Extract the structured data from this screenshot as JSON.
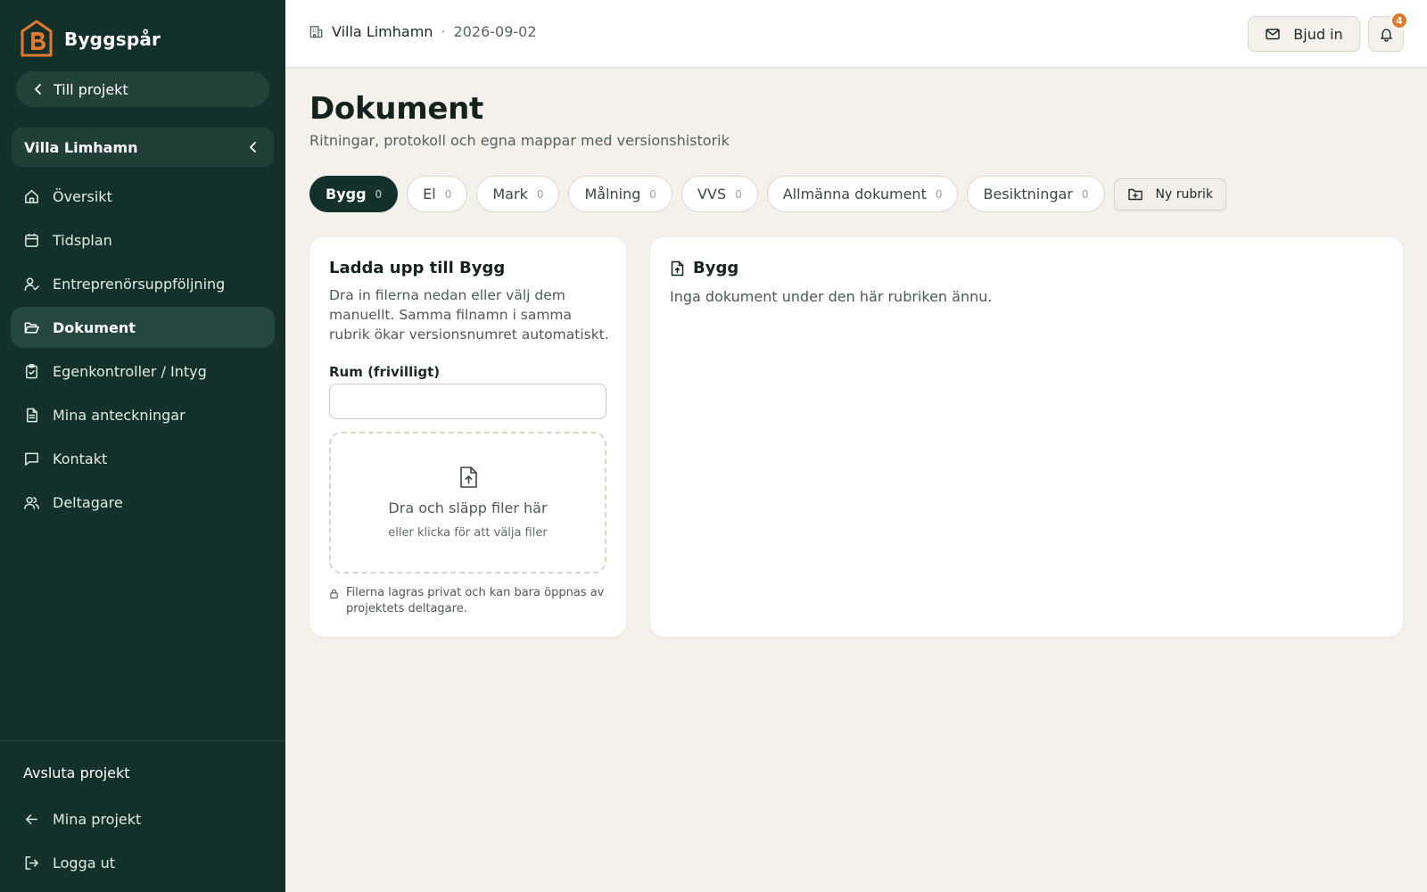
{
  "app": {
    "name": "Byggspår"
  },
  "sidebar": {
    "back_label": "Till projekt",
    "project_name": "Villa Limhamn",
    "items": [
      {
        "label": "Översikt",
        "icon": "home-icon",
        "active": false
      },
      {
        "label": "Tidsplan",
        "icon": "calendar-icon",
        "active": false
      },
      {
        "label": "Entreprenörsuppföljning",
        "icon": "user-check-icon",
        "active": false
      },
      {
        "label": "Dokument",
        "icon": "folder-open-icon",
        "active": true
      },
      {
        "label": "Egenkontroller / Intyg",
        "icon": "clipboard-check-icon",
        "active": false
      },
      {
        "label": "Mina anteckningar",
        "icon": "notes-icon",
        "active": false
      },
      {
        "label": "Kontakt",
        "icon": "message-icon",
        "active": false
      },
      {
        "label": "Deltagare",
        "icon": "users-icon",
        "active": false
      }
    ],
    "end_project_label": "Avsluta projekt",
    "my_projects_label": "Mina projekt",
    "logout_label": "Logga ut"
  },
  "header": {
    "project": "Villa Limhamn",
    "separator": "·",
    "date": "2026-09-02",
    "invite_label": "Bjud in",
    "notification_count": "4"
  },
  "main": {
    "title": "Dokument",
    "subtitle": "Ritningar, protokoll och egna mappar med versionshistorik",
    "tabs": [
      {
        "label": "Bygg",
        "count": "0",
        "active": true
      },
      {
        "label": "El",
        "count": "0",
        "active": false
      },
      {
        "label": "Mark",
        "count": "0",
        "active": false
      },
      {
        "label": "Målning",
        "count": "0",
        "active": false
      },
      {
        "label": "VVS",
        "count": "0",
        "active": false
      },
      {
        "label": "Allmänna dokument",
        "count": "0",
        "active": false
      },
      {
        "label": "Besiktningar",
        "count": "0",
        "active": false
      }
    ],
    "new_category_label": "Ny rubrik",
    "upload": {
      "title": "Ladda upp till Bygg",
      "description": "Dra in filerna nedan eller välj dem manuellt. Samma filnamn i samma rubrik ökar versionsnumret automatiskt.",
      "room_label": "Rum (frivilligt)",
      "room_value": "",
      "drop_main": "Dra och släpp filer här",
      "drop_sub": "eller klicka för att välja filer",
      "privacy_note": "Filerna lagras privat och kan bara öppnas av projektets deltagare."
    },
    "documents": {
      "title": "Bygg",
      "empty_text": "Inga dokument under den här rubriken ännu."
    }
  },
  "colors": {
    "sidebar_bg": "#14302a",
    "sidebar_active": "#264740",
    "page_bg": "#f4f1ea",
    "accent": "#df7a2c"
  }
}
